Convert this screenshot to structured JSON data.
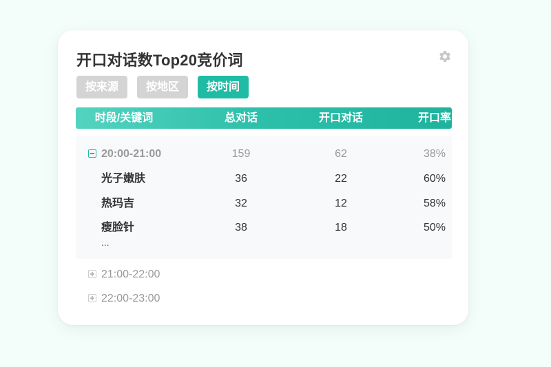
{
  "title": "开口对话数Top20竞价词",
  "tabs": [
    {
      "label": "按来源",
      "active": false
    },
    {
      "label": "按地区",
      "active": false
    },
    {
      "label": "按时间",
      "active": true
    }
  ],
  "table": {
    "headers": [
      "时段/关键词",
      "总对话",
      "开口对话",
      "开口率"
    ],
    "expanded_group": {
      "period": "20:00-21:00",
      "total": "159",
      "open": "62",
      "rate": "38%",
      "rows": [
        {
          "keyword": "光子嫩肤",
          "total": "36",
          "open": "22",
          "rate": "60%"
        },
        {
          "keyword": "热玛吉",
          "total": "32",
          "open": "12",
          "rate": "58%"
        },
        {
          "keyword": "瘦脸针",
          "total": "38",
          "open": "18",
          "rate": "50%"
        }
      ],
      "more": "..."
    },
    "collapsed_groups": [
      {
        "period": "21:00-22:00"
      },
      {
        "period": "22:00-23:00"
      }
    ]
  },
  "colors": {
    "accent": "#1fbba4",
    "tab_inactive": "#d4d4d4",
    "background": "#f3fdfa"
  },
  "icons": {
    "settings": "gear-icon",
    "collapse": "minus-square-icon",
    "expand": "plus-square-icon"
  }
}
